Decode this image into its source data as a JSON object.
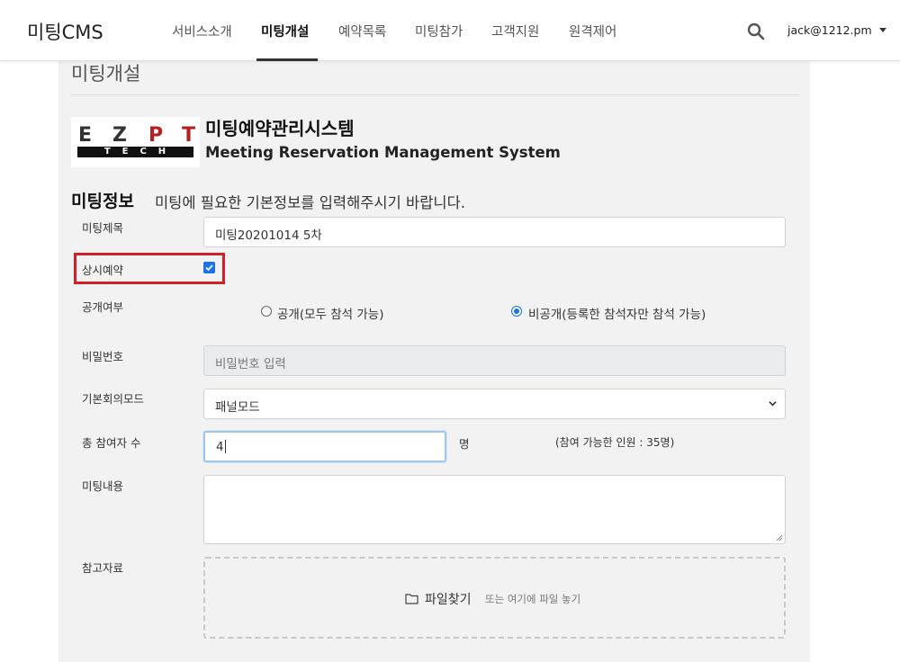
{
  "header": {
    "brand": "미팅CMS",
    "nav": [
      {
        "label": "서비스소개",
        "active": false
      },
      {
        "label": "미팅개설",
        "active": true
      },
      {
        "label": "예약목록",
        "active": false
      },
      {
        "label": "미팅참가",
        "active": false
      },
      {
        "label": "고객지원",
        "active": false
      },
      {
        "label": "원격제어",
        "active": false
      }
    ],
    "search_icon": "search-icon",
    "user": "jack@1212.pm"
  },
  "page": {
    "title": "미팅개설"
  },
  "logo": {
    "letters": [
      "E",
      "Z",
      "P",
      "T"
    ],
    "subtext": "TECH",
    "accent_color": "#b22222"
  },
  "system": {
    "title": "미팅예약관리시스템",
    "subtitle": "Meeting Reservation Management System"
  },
  "section": {
    "title": "미팅정보",
    "description": "미팅에 필요한 기본정보를 입력해주시기 바랍니다."
  },
  "form": {
    "meeting_title": {
      "label": "미팅제목",
      "value": "미팅20201014 5차"
    },
    "always_reserve": {
      "label": "상시예약",
      "checked": true
    },
    "visibility": {
      "label": "공개여부",
      "options": [
        {
          "label": "공개(모두 참석 가능)",
          "checked": false
        },
        {
          "label": "비공개(등록한 참석자만 참석 가능)",
          "checked": true
        }
      ]
    },
    "password": {
      "label": "비밀번호",
      "placeholder": "비밀번호 입력"
    },
    "mode": {
      "label": "기본회의모드",
      "value": "패널모드"
    },
    "participants": {
      "label": "총 참여자 수",
      "value": "4",
      "unit": "명",
      "capacity": "(참여 가능한 인원 : 35명)"
    },
    "content": {
      "label": "미팅내용",
      "value": ""
    },
    "attachment": {
      "label": "참고자료",
      "button": "파일찾기",
      "hint": "또는 여기에 파일 놓기"
    }
  },
  "colors": {
    "highlight": "#d0202a",
    "accent": "#1a73e8"
  }
}
